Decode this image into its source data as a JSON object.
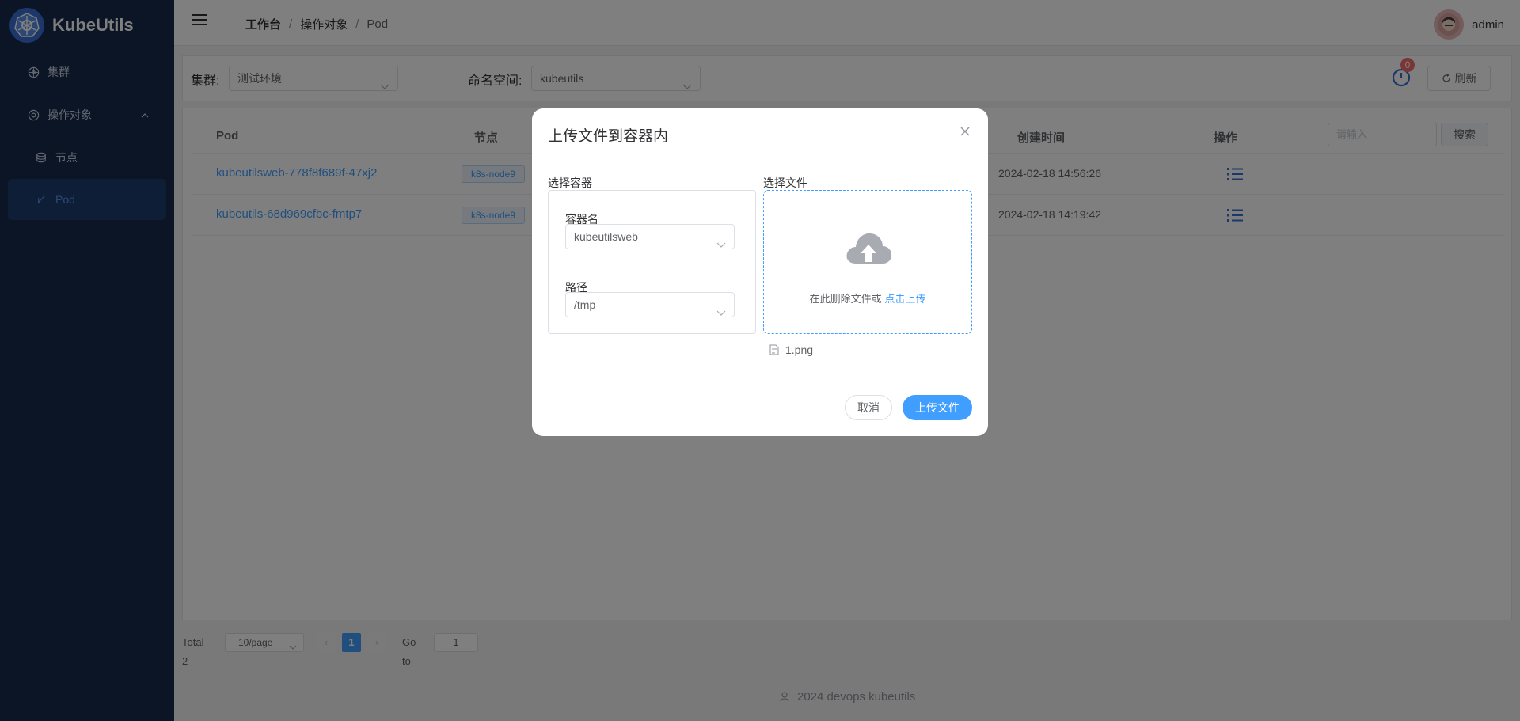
{
  "app": {
    "name": "KubeUtils"
  },
  "sidebar": {
    "items": [
      {
        "label": "集群",
        "icon": "cluster-icon"
      },
      {
        "label": "操作对象",
        "icon": "objects-icon",
        "expanded": true
      },
      {
        "label": "节点",
        "icon": "node-icon"
      },
      {
        "label": "Pod",
        "icon": "pod-icon",
        "active": true
      }
    ]
  },
  "header": {
    "breadcrumb": [
      "工作台",
      "操作对象",
      "Pod"
    ],
    "separator": "/",
    "user": "admin"
  },
  "filter": {
    "cluster_label": "集群:",
    "cluster_value": "测试环境",
    "namespace_label": "命名空间:",
    "namespace_value": "kubeutils",
    "notification_count": "0",
    "refresh_label": "刷新"
  },
  "table": {
    "columns": {
      "pod": "Pod",
      "node": "节点",
      "created": "创建时间",
      "actions": "操作"
    },
    "search_placeholder": "请输入",
    "search_label": "搜索",
    "rows": [
      {
        "pod": "kubeutilsweb-778f8f689f-47xj2",
        "node": "k8s-node9",
        "created": "2024-02-18 14:56:26"
      },
      {
        "pod": "kubeutils-68d969cfbc-fmtp7",
        "node": "k8s-node9",
        "created": "2024-02-18 14:19:42"
      }
    ]
  },
  "pagination": {
    "total": "Total 2",
    "page_size": "10/page",
    "prev": "‹",
    "current": "1",
    "next": "›",
    "goto_label": "Go to",
    "goto_value": "1"
  },
  "footer": {
    "text": "2024 devops kubeutils"
  },
  "dialog": {
    "title": "上传文件到容器内",
    "select_container_label": "选择容器",
    "select_file_label": "选择文件",
    "container_name_label": "容器名",
    "container_name_value": "kubeutilsweb",
    "path_label": "路径",
    "path_value": "/tmp",
    "drop_text": "在此删除文件或",
    "click_upload": "点击上传",
    "file_name": "1.png",
    "cancel_label": "取消",
    "upload_label": "上传文件"
  },
  "colors": {
    "sidebar_bg": "#172a4a",
    "accent": "#409eff",
    "badge": "#f56c6c"
  }
}
